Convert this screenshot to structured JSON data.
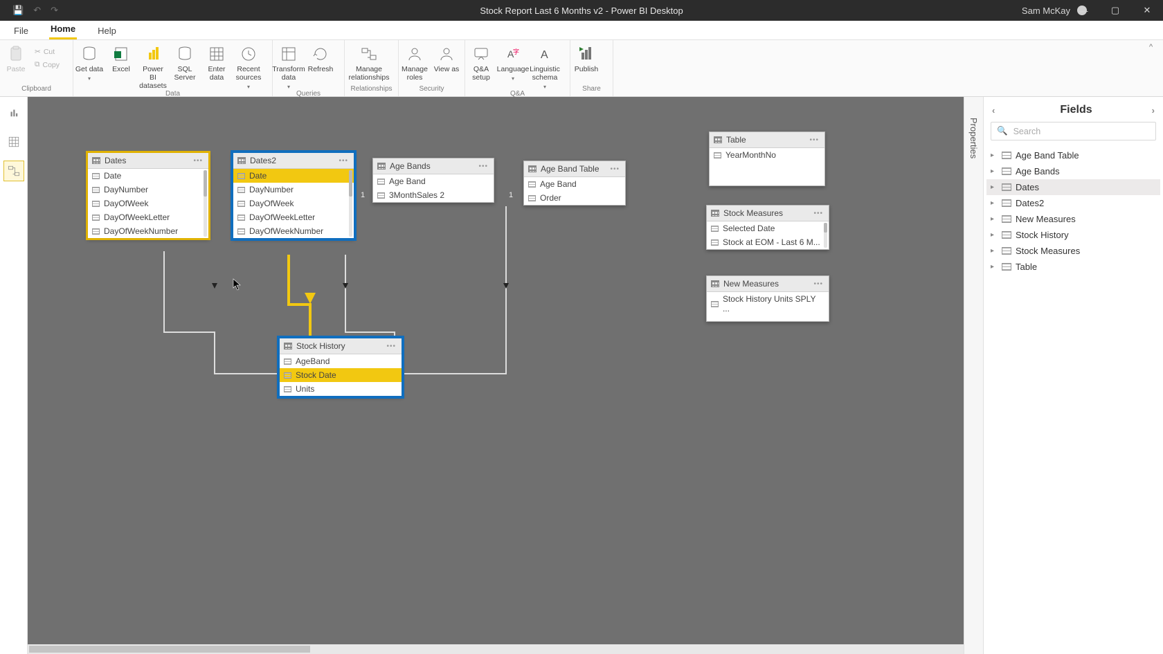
{
  "title": "Stock Report Last 6 Months v2 - Power BI Desktop",
  "user": "Sam McKay",
  "menutabs": {
    "file": "File",
    "home": "Home",
    "help": "Help"
  },
  "ribbon": {
    "clipboard": {
      "label": "Clipboard",
      "paste": "Paste",
      "cut": "Cut",
      "copy": "Copy"
    },
    "data": {
      "label": "Data",
      "getdata": "Get data",
      "excel": "Excel",
      "pbidata": "Power BI datasets",
      "sql": "SQL Server",
      "enter": "Enter data",
      "recent": "Recent sources"
    },
    "queries": {
      "label": "Queries",
      "transform": "Transform data",
      "refresh": "Refresh"
    },
    "relationships": {
      "label": "Relationships",
      "manage": "Manage relationships"
    },
    "security": {
      "label": "Security",
      "roles": "Manage roles",
      "viewas": "View as"
    },
    "qa": {
      "label": "Q&A",
      "setup": "Q&A setup",
      "language": "Language",
      "schema": "Linguistic schema"
    },
    "share": {
      "label": "Share",
      "publish": "Publish"
    }
  },
  "tables": {
    "dates": {
      "title": "Dates",
      "fields": [
        "Date",
        "DayNumber",
        "DayOfWeek",
        "DayOfWeekLetter",
        "DayOfWeekNumber"
      ]
    },
    "dates2": {
      "title": "Dates2",
      "fields": [
        "Date",
        "DayNumber",
        "DayOfWeek",
        "DayOfWeekLetter",
        "DayOfWeekNumber"
      ]
    },
    "agebands": {
      "title": "Age Bands",
      "fields": [
        "Age Band",
        "3MonthSales 2"
      ]
    },
    "agebandtable": {
      "title": "Age Band Table",
      "fields": [
        "Age Band",
        "Order"
      ]
    },
    "stockhistory": {
      "title": "Stock History",
      "fields": [
        "AgeBand",
        "Stock Date",
        "Units"
      ]
    },
    "tabletbl": {
      "title": "Table",
      "fields": [
        "YearMonthNo"
      ]
    },
    "stockmeasures": {
      "title": "Stock Measures",
      "fields": [
        "Selected Date",
        "Stock at EOM - Last 6 M..."
      ]
    },
    "newmeasures": {
      "title": "New Measures",
      "fields": [
        "Stock History Units SPLY ..."
      ]
    }
  },
  "fieldspane": {
    "title": "Fields",
    "search_placeholder": "Search",
    "items": [
      "Age Band Table",
      "Age Bands",
      "Dates",
      "Dates2",
      "New Measures",
      "Stock History",
      "Stock Measures",
      "Table"
    ],
    "selected": "Dates"
  },
  "properties_label": "Properties",
  "rel_one": "1"
}
